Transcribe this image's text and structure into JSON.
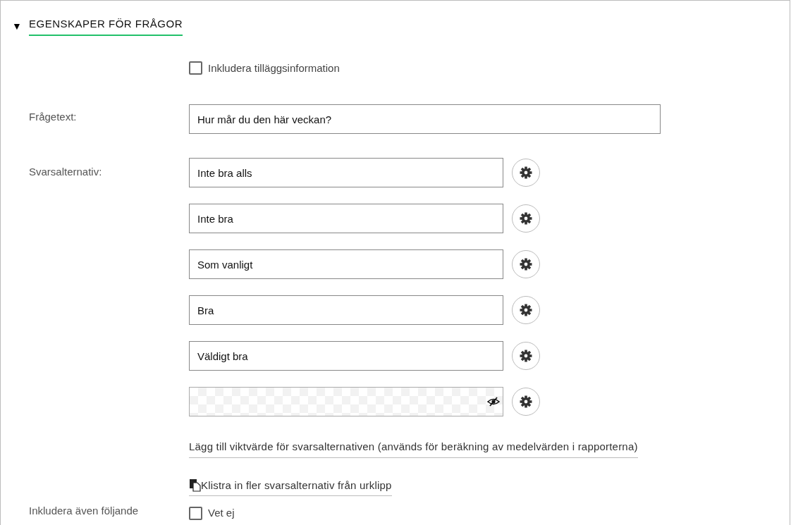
{
  "section": {
    "title": "EGENSKAPER FÖR FRÅGOR",
    "expanded": true,
    "toggle": "▼"
  },
  "extra_info": {
    "label": "Inkludera tilläggsinformation",
    "checked": false
  },
  "question": {
    "label": "Frågetext:",
    "value": "Hur mår du den här veckan?"
  },
  "answers": {
    "label": "Svarsalternativ:",
    "options": [
      {
        "kind": "text",
        "value": "Inte bra alls"
      },
      {
        "kind": "text",
        "value": "Inte bra"
      },
      {
        "kind": "text",
        "value": "Som vanligt"
      },
      {
        "kind": "text",
        "value": "Bra"
      },
      {
        "kind": "text",
        "value": "Väldigt bra"
      },
      {
        "kind": "hidden"
      }
    ]
  },
  "links": [
    {
      "kind": "plain",
      "text": "Lägg till viktvärde för svarsalternativen (används för beräkning av medelvärden i rapporterna)"
    },
    {
      "kind": "paste",
      "text": "Klistra in fler svarsalternativ från urklipp"
    }
  ],
  "include_also": {
    "label": "Inkludera även följande",
    "options": [
      {
        "label": "Vet ej",
        "checked": false
      }
    ]
  }
}
